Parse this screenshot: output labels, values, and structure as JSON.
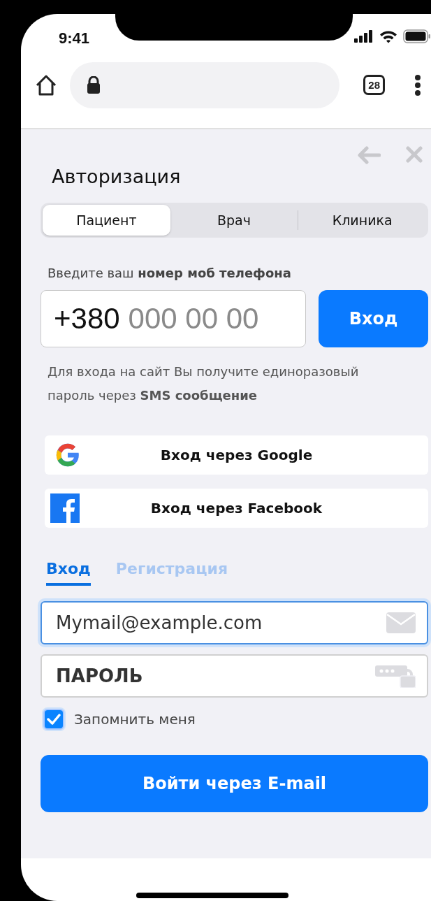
{
  "status_bar": {
    "time": "9:41"
  },
  "browser": {
    "tab_count": "28"
  },
  "title": "Авторизация",
  "role_tabs": [
    {
      "label": "Пациент",
      "selected": true
    },
    {
      "label": "Врач",
      "selected": false
    },
    {
      "label": "Клиника",
      "selected": false
    }
  ],
  "phone_prompt": "Введите ваш **номер моб телефона**",
  "phone": {
    "code": "+380",
    "placeholder": "000 00 00"
  },
  "phone_button": "Вход",
  "sms_note": "Для входа на сайт Вы получите единоразовый пароль через **SMS сообщение**",
  "social_buttons": [
    {
      "kind": "google",
      "label": "Вход через Google"
    },
    {
      "kind": "facebook",
      "label": "Вход через Facebook"
    }
  ],
  "auth_tabs": [
    {
      "label": "Вход",
      "selected": true
    },
    {
      "label": "Регистрация",
      "selected": false
    }
  ],
  "email": {
    "value": "Mymail@example.com",
    "focused": true
  },
  "password": {
    "placeholder": "ПАРОЛЬ"
  },
  "remember": {
    "label": "Запомнить меня",
    "checked": true
  },
  "submit": "Войти через E-mail"
}
